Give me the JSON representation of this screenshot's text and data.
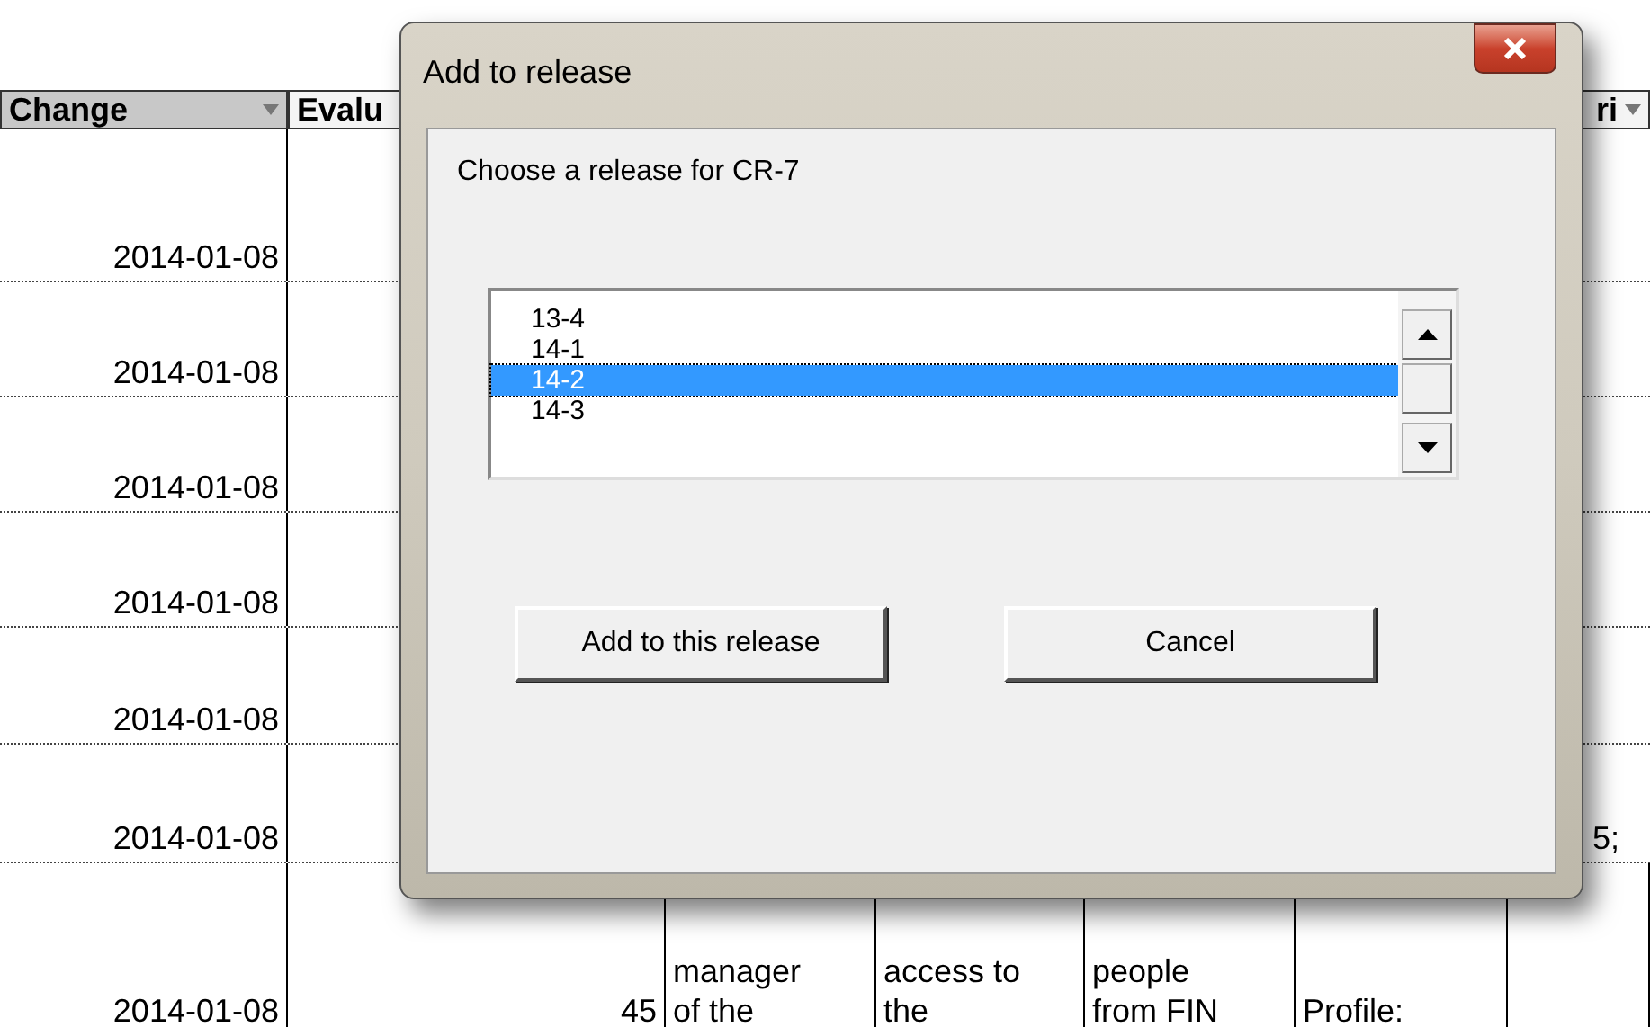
{
  "sheet": {
    "columns": [
      {
        "label": "Change"
      },
      {
        "label": "Evalu"
      },
      {},
      {},
      {},
      {},
      {
        "label": "ri"
      }
    ],
    "rows": [
      {
        "change": [
          "2014-01-08"
        ]
      },
      {
        "change": [
          "2014-01-08"
        ]
      },
      {
        "change": [
          "2014-01-08"
        ]
      },
      {
        "change": [
          "2014-01-08"
        ]
      },
      {
        "change": [
          "2014-01-08"
        ]
      },
      {
        "change": [
          "2014-01-08"
        ],
        "column_7": [
          "5;"
        ]
      },
      {
        "change": [
          "2014-01-08"
        ],
        "evalu": [
          "45"
        ],
        "column_3": [
          "manager",
          "of the"
        ],
        "column_4": [
          "access to",
          "the"
        ],
        "column_5": [
          "people",
          "from FIN"
        ],
        "column_6": [
          "Profile:"
        ]
      }
    ]
  },
  "dialog": {
    "title": "Add to release",
    "prompt": "Choose a release for CR-7",
    "releases": [
      {
        "label": "13-4",
        "selected": false
      },
      {
        "label": "14-1",
        "selected": false
      },
      {
        "label": "14-2",
        "selected": true
      },
      {
        "label": "14-3",
        "selected": false
      }
    ],
    "buttons": [
      "Add to this release",
      "Cancel"
    ]
  }
}
